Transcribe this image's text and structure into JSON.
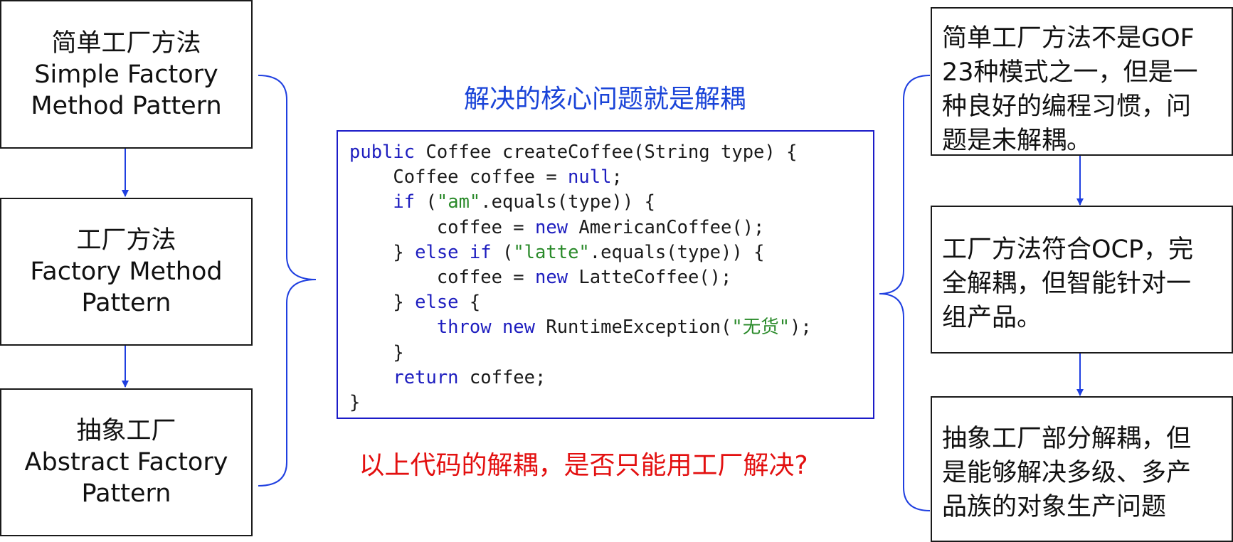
{
  "left_boxes": [
    {
      "lines": [
        "简单工厂方法",
        "Simple Factory",
        "Method Pattern"
      ]
    },
    {
      "lines": [
        "工厂方法",
        "Factory Method",
        "Pattern"
      ]
    },
    {
      "lines": [
        "抽象工厂",
        "Abstract Factory",
        "Pattern"
      ]
    }
  ],
  "center": {
    "title": "解决的核心问题就是解耦",
    "question": "以上代码的解耦，是否只能用工厂解决?",
    "code_lines": [
      "public Coffee createCoffee(String type) {",
      "    Coffee coffee = null;",
      "    if (\"am\".equals(type)) {",
      "        coffee = new AmericanCoffee();",
      "    } else if (\"latte\".equals(type)) {",
      "        coffee = new LatteCoffee();",
      "    } else {",
      "        throw new RuntimeException(\"无货\");",
      "    }",
      "    return coffee;",
      "}"
    ]
  },
  "right_boxes": [
    {
      "lines": [
        "简单工厂方法不是GOF",
        "23种模式之一，但是一",
        "种良好的编程习惯，问",
        "题是未解耦。"
      ]
    },
    {
      "lines": [
        "工厂方法符合OCP，完",
        "全解耦，但智能针对一",
        "组产品。"
      ]
    },
    {
      "lines": [
        "抽象工厂部分解耦，但",
        "是能够解决多级、多产",
        "品族的对象生产问题"
      ]
    }
  ],
  "colors": {
    "title": "#1a44d8",
    "question": "#e31010",
    "arrow": "#1f3fe0",
    "brace": "#1f3fe0",
    "keyword": "#1d1dbf",
    "string": "#2a8a2a"
  }
}
